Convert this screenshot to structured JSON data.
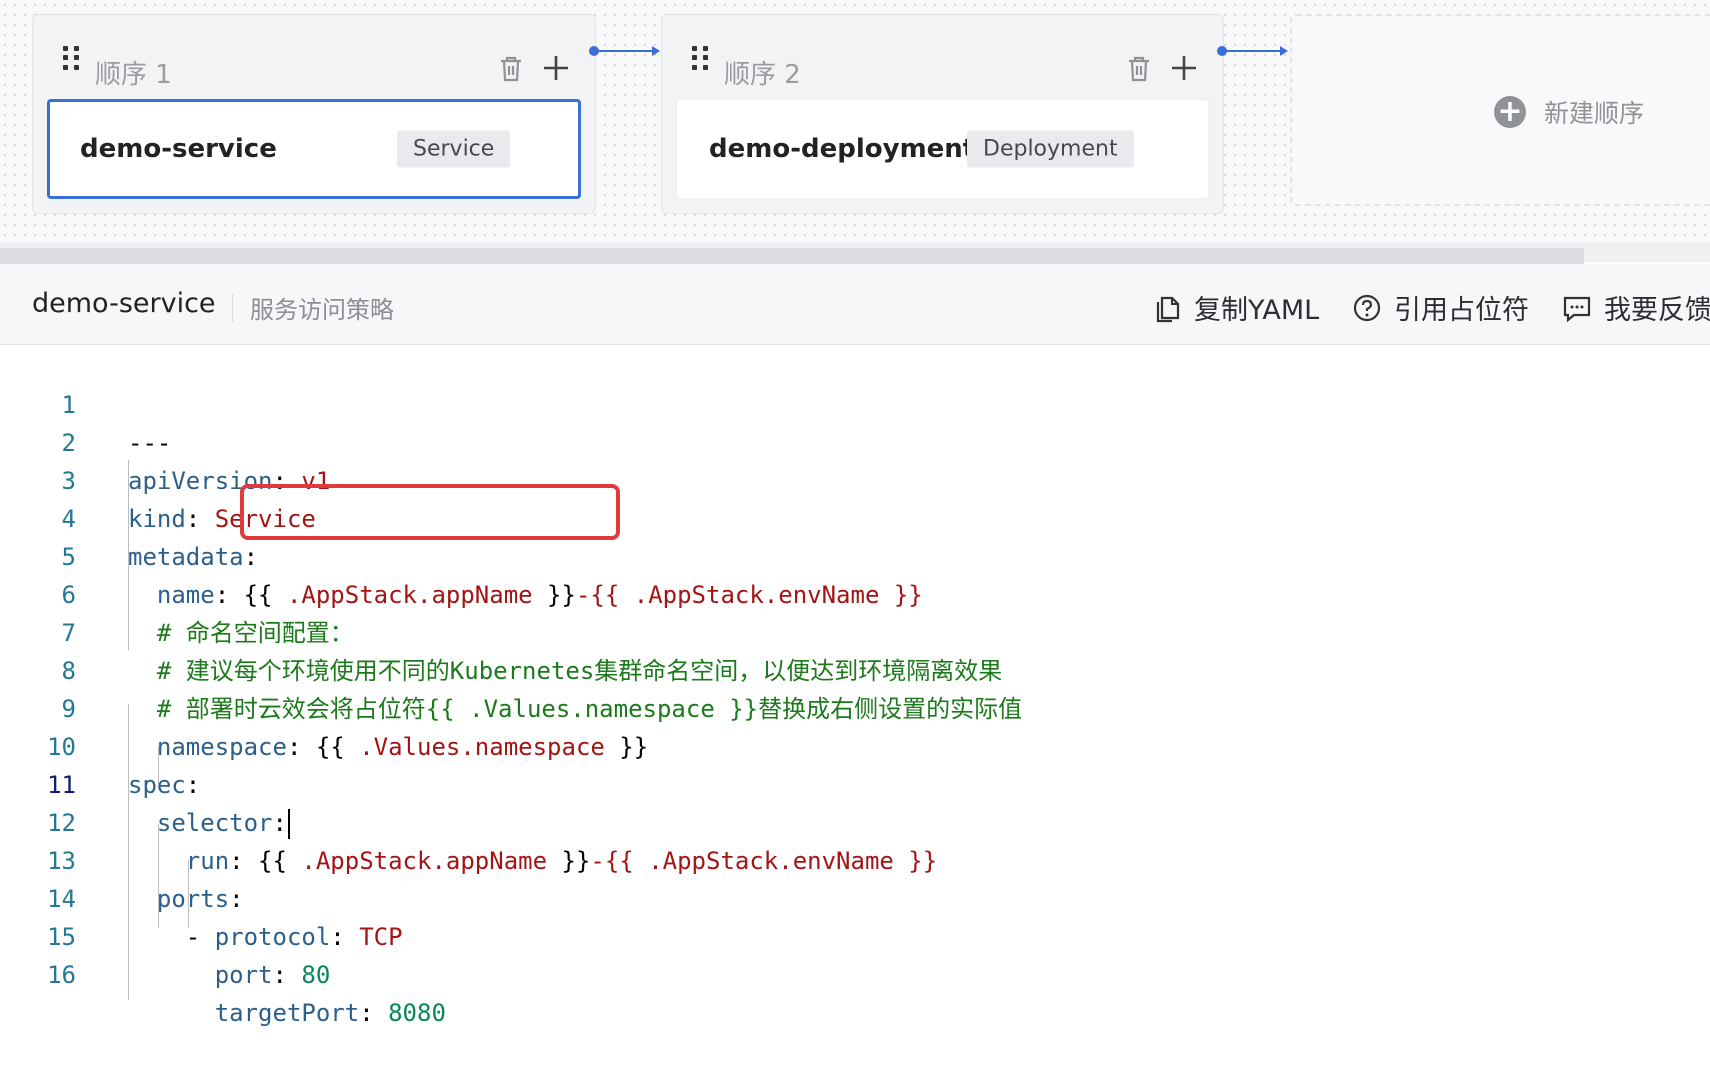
{
  "pipeline": {
    "stages": [
      {
        "title": "顺序 1",
        "cards": [
          {
            "name": "demo-service",
            "type": "Service",
            "selected": true
          }
        ]
      },
      {
        "title": "顺序 2",
        "cards": [
          {
            "name": "demo-deployment",
            "type": "Deployment",
            "selected": false
          }
        ]
      }
    ],
    "new_stage_label": "新建顺序"
  },
  "toolbar": {
    "title": "demo-service",
    "subtitle": "服务访问策略",
    "actions": [
      {
        "label": "复制YAML",
        "icon": "copy-icon"
      },
      {
        "label": "引用占位符",
        "icon": "question-circle-icon"
      },
      {
        "label": "我要反馈",
        "icon": "comment-icon"
      }
    ]
  },
  "editor": {
    "active_line": 11,
    "lines": [
      {
        "num": "1",
        "text": "---"
      },
      {
        "num": "2",
        "text": "apiVersion: v1"
      },
      {
        "num": "3",
        "text": "kind: Service"
      },
      {
        "num": "4",
        "text": "metadata:"
      },
      {
        "num": "5",
        "text": "  name: {{ .AppStack.appName }}-{{ .AppStack.envName }}"
      },
      {
        "num": "6",
        "text": "  # 命名空间配置："
      },
      {
        "num": "7",
        "text": "  # 建议每个环境使用不同的Kubernetes集群命名空间，以便达到环境隔离效果"
      },
      {
        "num": "8",
        "text": "  # 部署时云效会将占位符{{ .Values.namespace }}替换成右侧设置的实际值"
      },
      {
        "num": "9",
        "text": "  namespace: {{ .Values.namespace }}"
      },
      {
        "num": "10",
        "text": "spec:"
      },
      {
        "num": "11",
        "text": "  selector:"
      },
      {
        "num": "12",
        "text": "    run: {{ .AppStack.appName }}-{{ .AppStack.envName }}"
      },
      {
        "num": "13",
        "text": "  ports:"
      },
      {
        "num": "14",
        "text": "    - protocol: TCP"
      },
      {
        "num": "15",
        "text": "      port: 80"
      },
      {
        "num": "16",
        "text": "      targetPort: 8080"
      }
    ]
  },
  "colors": {
    "accent": "#3b6fd6",
    "highlight_box": "#e03a3a",
    "yaml_key": "#2c5f8a",
    "yaml_string": "#a31515",
    "yaml_number": "#098658",
    "yaml_comment": "#1c7a1c"
  }
}
